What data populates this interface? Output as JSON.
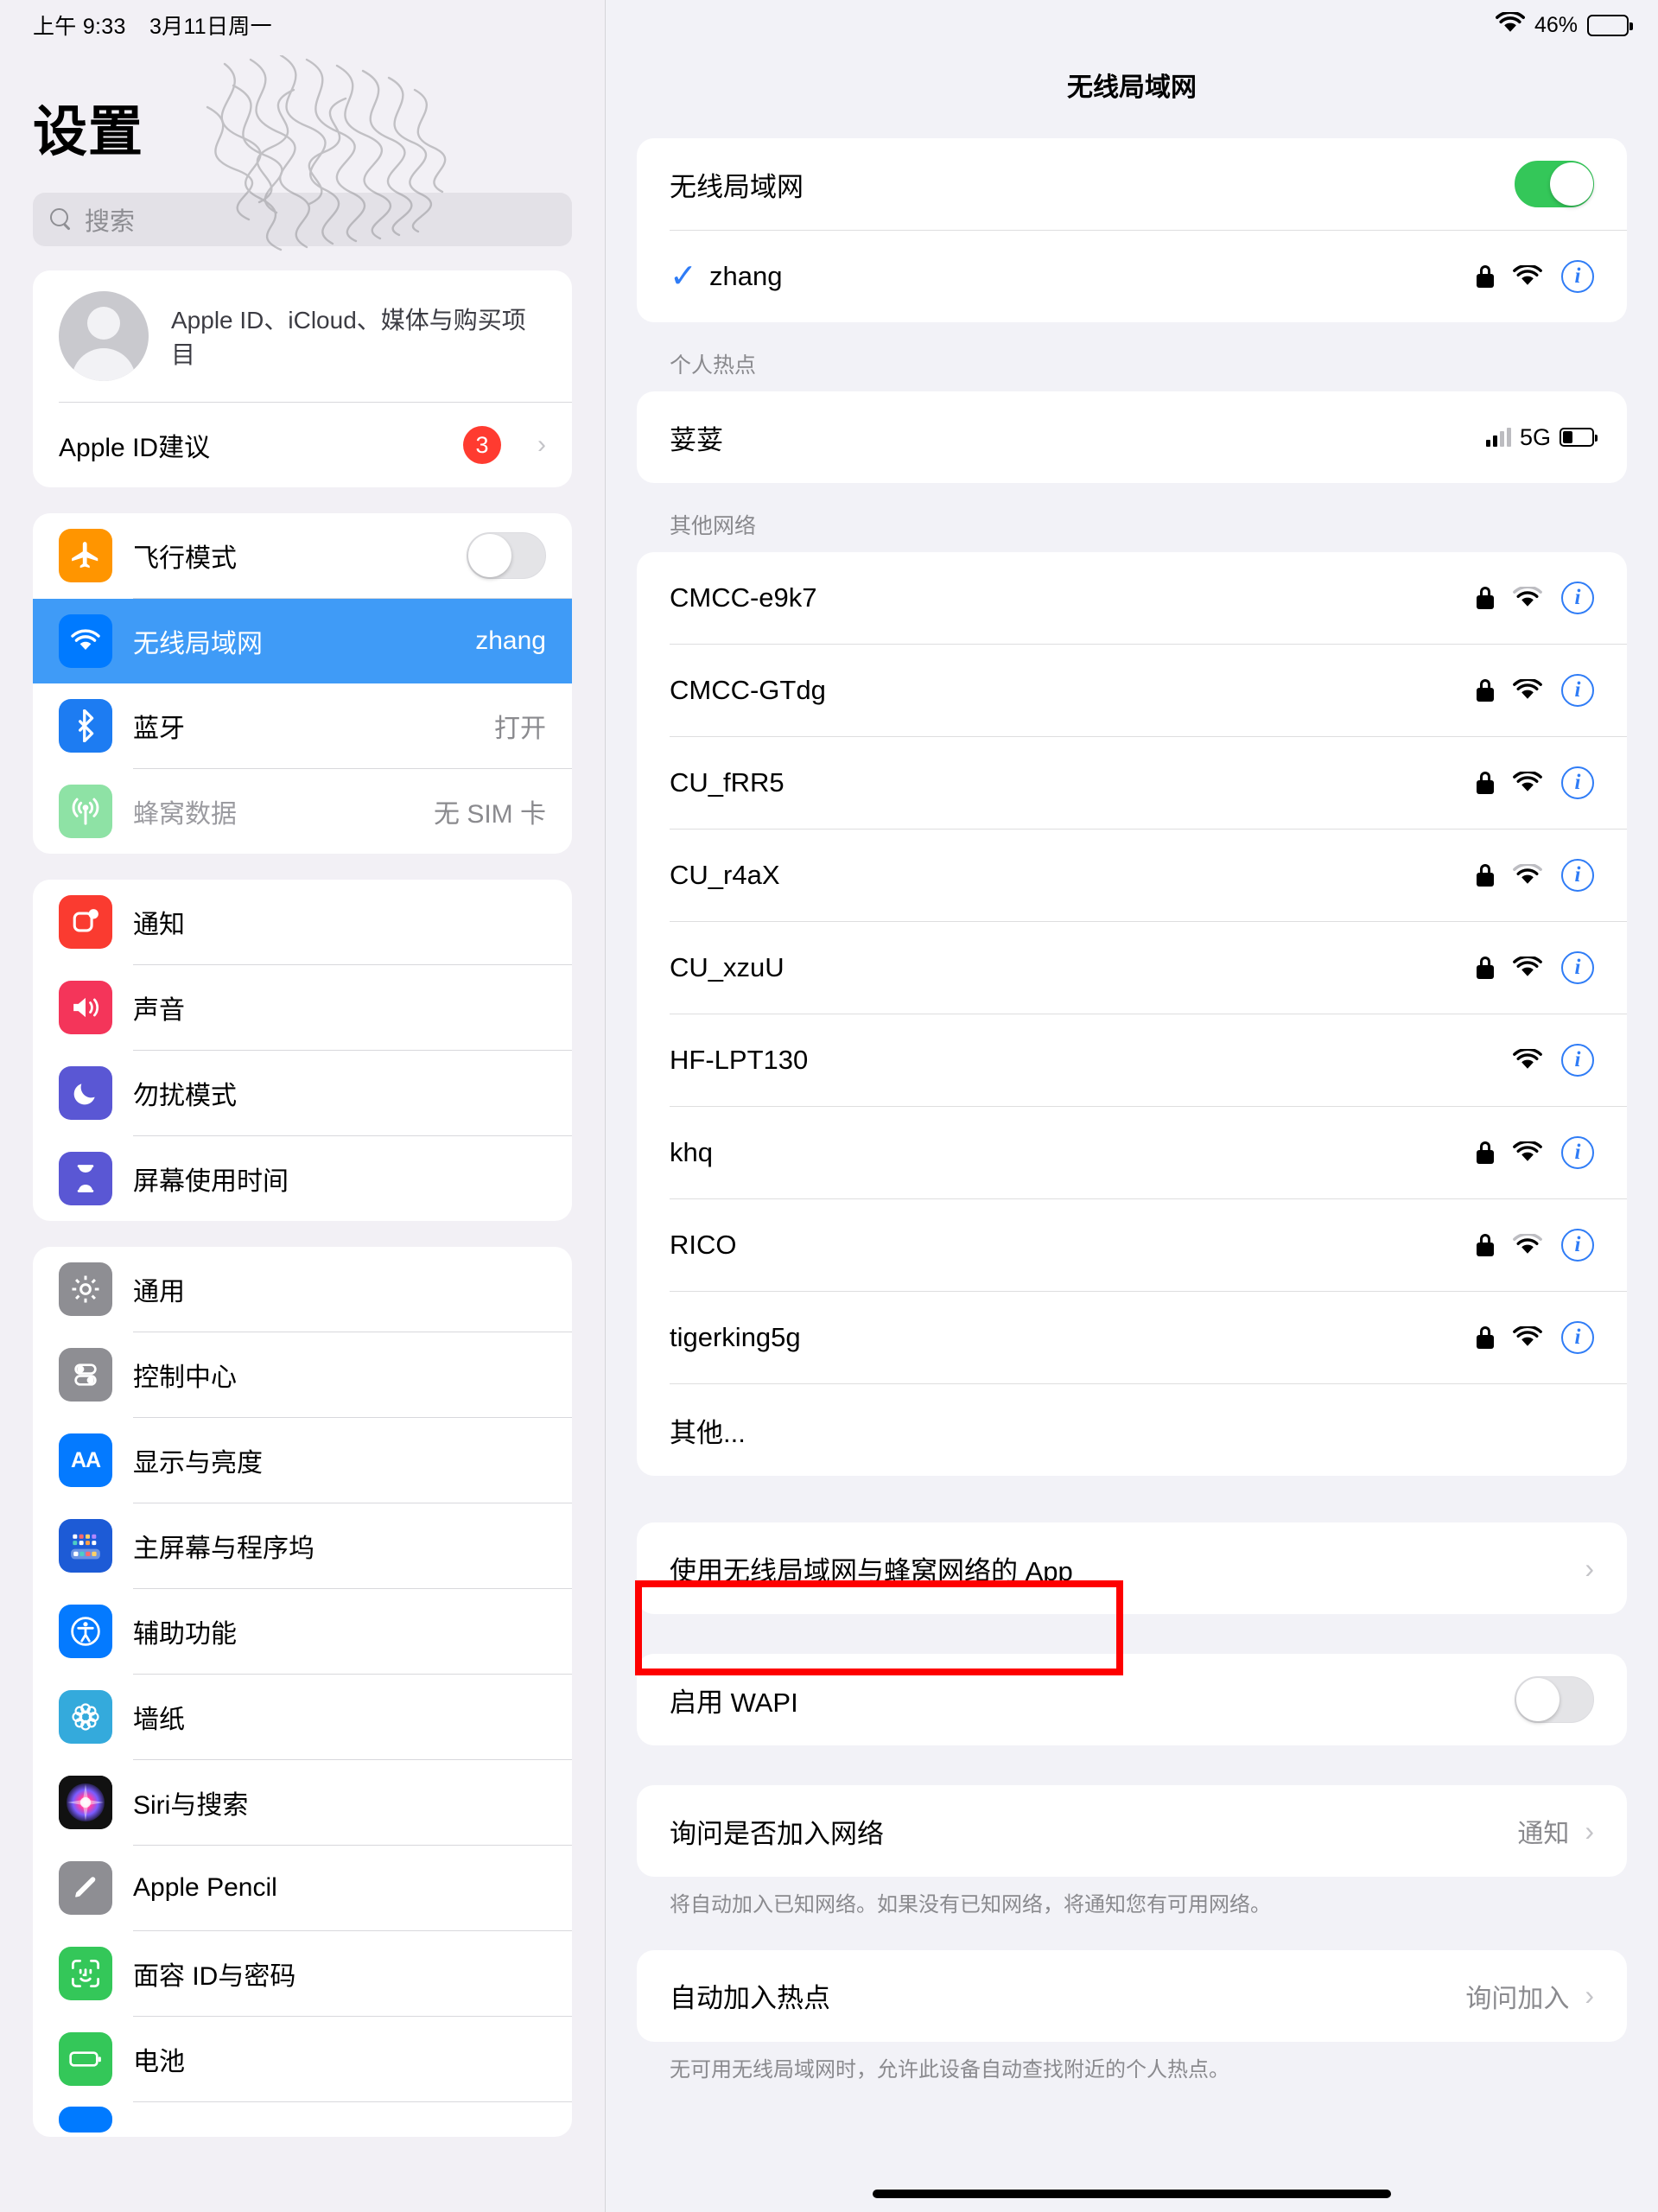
{
  "status_bar": {
    "time": "上午 9:33",
    "date": "3月11日周一",
    "wifi_icon": "wifi-icon",
    "battery_percent": "46%"
  },
  "sidebar": {
    "title": "设置",
    "search": {
      "placeholder": "搜索",
      "icon": "search-icon"
    },
    "account": {
      "subtitle": "Apple ID、iCloud、媒体与购买项目",
      "suggestion_label": "Apple ID建议",
      "suggestion_badge": "3",
      "chevron": "chevron-right-icon"
    },
    "groups": [
      {
        "items": [
          {
            "label": "飞行模式",
            "icon": "airplane-icon",
            "color": "#ff9500",
            "control": "toggle-off"
          },
          {
            "label": "无线局域网",
            "icon": "wifi-icon",
            "color": "#007aff",
            "value": "zhang",
            "selected": true
          },
          {
            "label": "蓝牙",
            "icon": "bluetooth-icon",
            "color": "#1d7cf2",
            "value": "打开"
          },
          {
            "label": "蜂窝数据",
            "icon": "cellular-icon",
            "color": "#8ee2a5",
            "value": "无 SIM 卡",
            "disabled": true
          }
        ]
      },
      {
        "items": [
          {
            "label": "通知",
            "icon": "notifications-icon",
            "color": "#ff3b30"
          },
          {
            "label": "声音",
            "icon": "sound-icon",
            "color": "#f43f5e"
          },
          {
            "label": "勿扰模式",
            "icon": "moon-icon",
            "color": "#5a57d4"
          },
          {
            "label": "屏幕使用时间",
            "icon": "hourglass-icon",
            "color": "#5a57d4"
          }
        ]
      },
      {
        "items": [
          {
            "label": "通用",
            "icon": "gear-icon",
            "color": "#8e8e93"
          },
          {
            "label": "控制中心",
            "icon": "control-center-icon",
            "color": "#8e8e93"
          },
          {
            "label": "显示与亮度",
            "icon": "display-aa-icon",
            "color": "#007aff"
          },
          {
            "label": "主屏幕与程序坞",
            "icon": "home-screen-icon",
            "color": "#1d5bd6"
          },
          {
            "label": "辅助功能",
            "icon": "accessibility-icon",
            "color": "#007aff"
          },
          {
            "label": "墙纸",
            "icon": "wallpaper-icon",
            "color": "#34aadc"
          },
          {
            "label": "Siri与搜索",
            "icon": "siri-icon",
            "color": "#1c1c1e"
          },
          {
            "label": "Apple Pencil",
            "icon": "pencil-icon",
            "color": "#8e8e93"
          },
          {
            "label": "面容 ID与密码",
            "icon": "face-id-icon",
            "color": "#34c759"
          },
          {
            "label": "电池",
            "icon": "battery-icon",
            "color": "#34c759"
          }
        ]
      }
    ]
  },
  "main": {
    "title": "无线局域网",
    "wifi_toggle": {
      "label": "无线局域网",
      "state": "on"
    },
    "connected": {
      "name": "zhang",
      "check_icon": "checkmark-icon",
      "lock_icon": "lock-icon",
      "wifi_icon": "wifi-signal-icon",
      "info_icon": "info-circle-icon"
    },
    "hotspot_header": "个人热点",
    "hotspot": {
      "name": "荽荽",
      "signal_icon": "cellular-bars-icon",
      "network_type": "5G",
      "battery_icon": "battery-icon"
    },
    "other_header": "其他网络",
    "networks": [
      {
        "name": "CMCC-e9k7",
        "locked": true,
        "signal": 2
      },
      {
        "name": "CMCC-GTdg",
        "locked": true,
        "signal": 3
      },
      {
        "name": "CU_fRR5",
        "locked": true,
        "signal": 3
      },
      {
        "name": "CU_r4aX",
        "locked": true,
        "signal": 2
      },
      {
        "name": "CU_xzuU",
        "locked": true,
        "signal": 3
      },
      {
        "name": "HF-LPT130",
        "locked": false,
        "signal": 3
      },
      {
        "name": "khq",
        "locked": true,
        "signal": 3
      },
      {
        "name": "RICO",
        "locked": true,
        "signal": 2
      },
      {
        "name": "tigerking5g",
        "locked": true,
        "signal": 3
      }
    ],
    "other_option": "其他...",
    "apps_row": {
      "label": "使用无线局域网与蜂窝网络的 App",
      "chevron": "chevron-right-icon"
    },
    "wapi_row": {
      "label": "启用 WAPI",
      "state": "off"
    },
    "ask_join": {
      "label": "询问是否加入网络",
      "value": "通知",
      "chevron": "chevron-right-icon",
      "footer": "将自动加入已知网络。如果没有已知网络，将通知您有可用网络。"
    },
    "auto_hotspot": {
      "label": "自动加入热点",
      "value": "询问加入",
      "chevron": "chevron-right-icon",
      "footer": "无可用无线局域网时，允许此设备自动查找附近的个人热点。"
    }
  },
  "annotation": {
    "highlight_color": "#fe0000",
    "target": "使用无线局域网与蜂窝网络的 App"
  }
}
